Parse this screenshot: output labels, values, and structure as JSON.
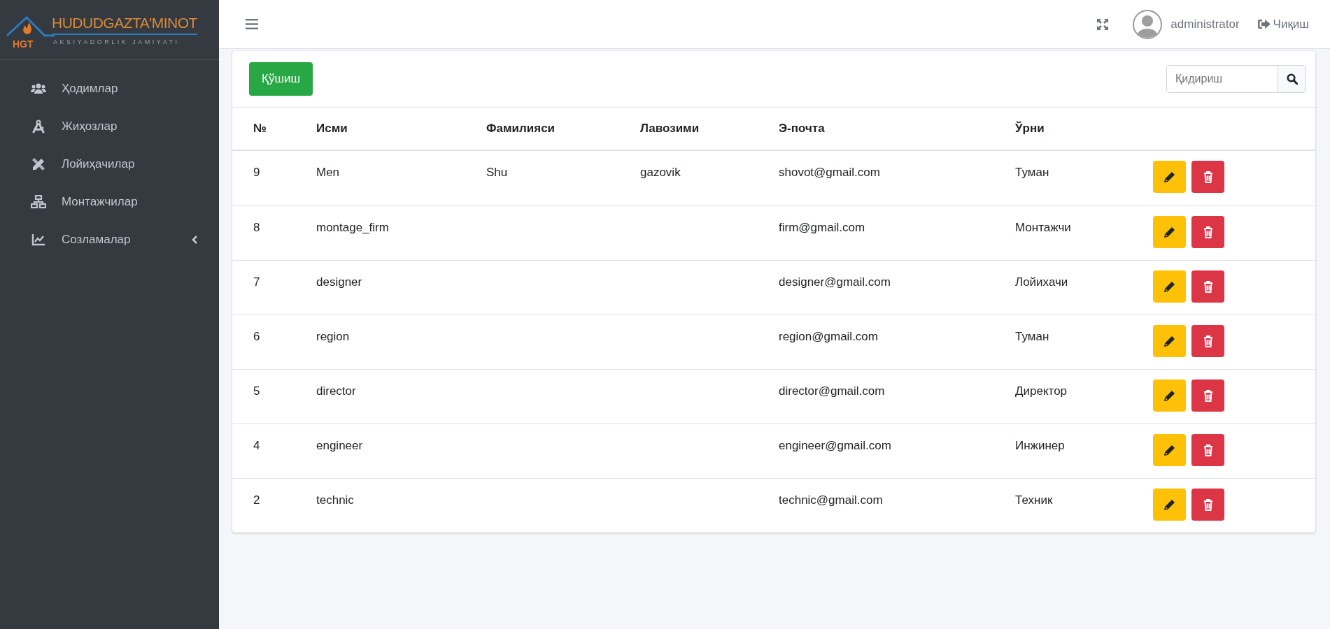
{
  "logo": {
    "title": "HUDUDGAZTA'MINOT",
    "subtitle": "AKSIYADORLIK JAMIYATI",
    "abbr": "HGT"
  },
  "sidebar": {
    "items": [
      {
        "label": "Ҳодимлар",
        "selected": false
      },
      {
        "label": "Жиҳозлар",
        "selected": false
      },
      {
        "label": "Лойиҳачилар",
        "selected": false
      },
      {
        "label": "Монтажчилар",
        "selected": false
      },
      {
        "label": "Созламалар",
        "selected": false,
        "expanded": false
      }
    ]
  },
  "header": {
    "user": "administrator",
    "logout": "Чиқиш"
  },
  "toolbar": {
    "add_button": "Қўшиш",
    "search": {
      "placeholder": "Қидириш"
    }
  },
  "table": {
    "columns": [
      "№",
      "Исми",
      "Фамилияси",
      "Лавозими",
      "Э-почта",
      "Ўрни"
    ],
    "rows": [
      {
        "cells": [
          "9",
          "Men",
          "Shu",
          "gazovik",
          "shovot@gmail.com",
          "Туман"
        ]
      },
      {
        "cells": [
          "8",
          "montage_firm",
          null,
          null,
          "firm@gmail.com",
          "Монтажчи"
        ]
      },
      {
        "cells": [
          "7",
          "designer",
          null,
          null,
          "designer@gmail.com",
          "Лойихачи"
        ]
      },
      {
        "cells": [
          "6",
          "region",
          null,
          null,
          "region@gmail.com",
          "Туман"
        ]
      },
      {
        "cells": [
          "5",
          "director",
          null,
          null,
          "director@gmail.com",
          "Директор"
        ]
      },
      {
        "cells": [
          "4",
          "engineer",
          null,
          null,
          "engineer@gmail.com",
          "Инжинер"
        ]
      },
      {
        "cells": [
          "2",
          "technic",
          null,
          null,
          "technic@gmail.com",
          "Техник"
        ]
      }
    ]
  }
}
